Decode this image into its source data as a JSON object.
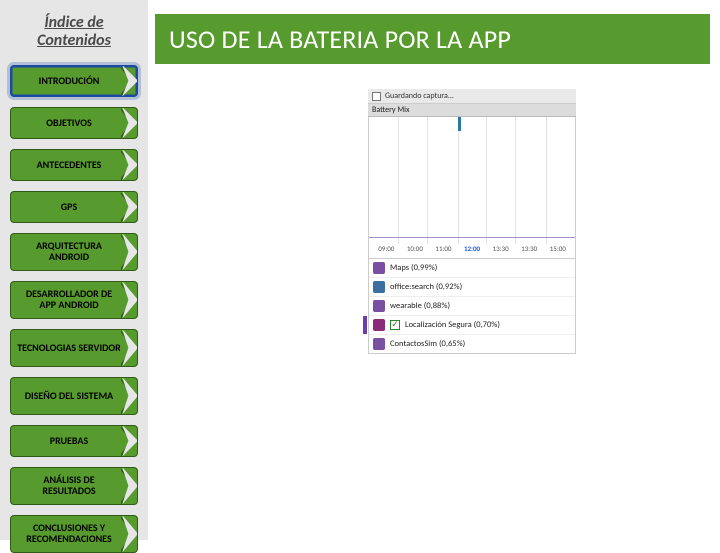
{
  "sidebar": {
    "title_line1": "Índice de",
    "title_line2": "Contenidos",
    "items": [
      "INTRODUCIÓN",
      "OBJETIVOS",
      "ANTECEDENTES",
      "GPS",
      "ARQUITECTURA ANDROID",
      "DESARROLLADOR DE APP ANDROID",
      "TECNOLOGIAS SERVIDOR",
      "DISEÑO DEL SISTEMA",
      "PRUEBAS",
      "ANÁLISIS DE RESULTADOS",
      "CONCLUSIONES Y RECOMENDACIONES"
    ]
  },
  "header": {
    "title": "USO DE LA BATERIA POR LA APP"
  },
  "shot": {
    "saving_label": "Guardando captura...",
    "section_label": "Battery Mix"
  },
  "chart_data": {
    "type": "line",
    "categories": [
      "09:00",
      "10:00",
      "11:00",
      "12:00",
      "13:30",
      "13:30",
      "15:00"
    ],
    "current_index": 3,
    "series": [
      {
        "name": "Maps",
        "pct": "0,99%"
      },
      {
        "name": "office:search",
        "pct": "0,92%"
      },
      {
        "name": "wearable",
        "pct": "0,88%"
      },
      {
        "name": "Localización Segura",
        "pct": "0,70%",
        "checked": true
      },
      {
        "name": "ContactosSim",
        "pct": "0,65%"
      }
    ],
    "title": "Battery Mix",
    "xlabel": "",
    "ylabel": "",
    "ylim": [
      0,
      100
    ]
  }
}
